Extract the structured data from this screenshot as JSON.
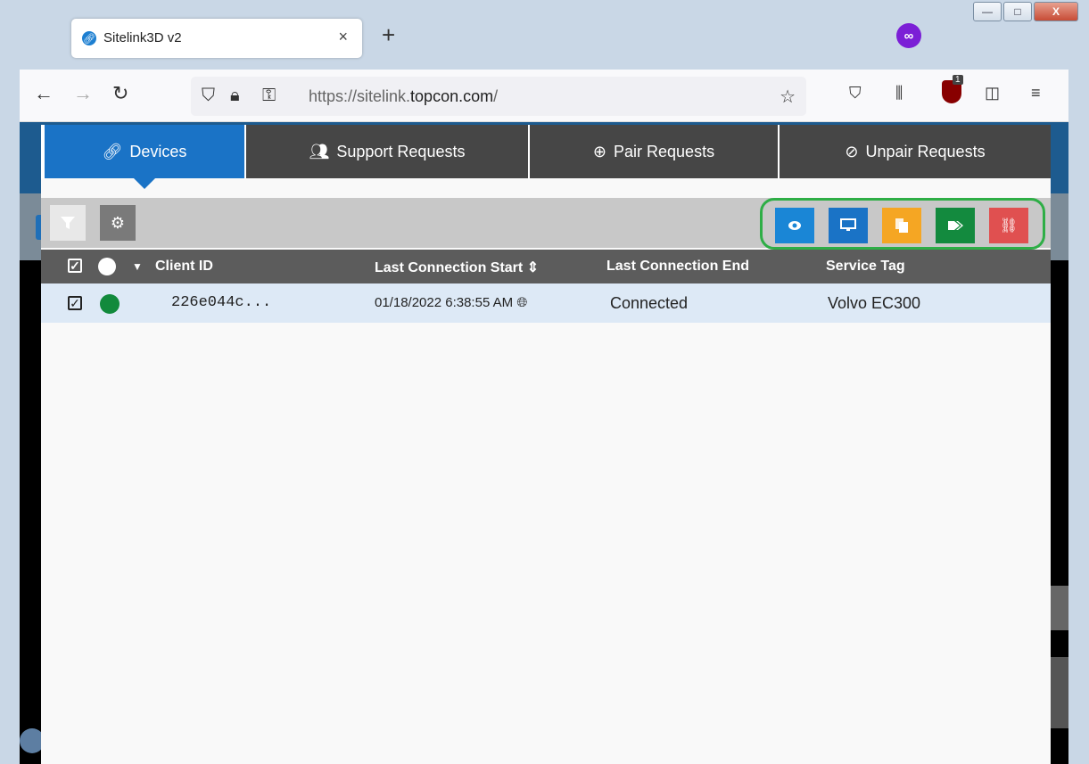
{
  "browser": {
    "tab_title": "Sitelink3D v2",
    "tab_close": "×",
    "new_tab": "+",
    "url_host_pre": "https://sitelink.",
    "url_host_bold": "topcon.com",
    "url_path": "/",
    "extension_badge_count": "1",
    "window_controls": {
      "minimize": "—",
      "maximize": "□",
      "close": "X"
    }
  },
  "modal": {
    "tabs": [
      {
        "label": "Devices",
        "icon": "link-icon",
        "active": true
      },
      {
        "label": "Support Requests",
        "icon": "users-gear-icon",
        "active": false
      },
      {
        "label": "Pair Requests",
        "icon": "plus-circle-icon",
        "active": false
      },
      {
        "label": "Unpair Requests",
        "icon": "ban-icon",
        "active": false
      }
    ],
    "actions": [
      {
        "name": "view",
        "icon": "eye-icon",
        "color": "#1a86d6"
      },
      {
        "name": "monitor",
        "icon": "monitor-icon",
        "color": "#1a73c6"
      },
      {
        "name": "copy",
        "icon": "files-icon",
        "color": "#f5a623"
      },
      {
        "name": "tags",
        "icon": "tags-icon",
        "color": "#138a3e"
      },
      {
        "name": "unlink",
        "icon": "unlink-icon",
        "color": "#e05050"
      }
    ],
    "table": {
      "columns": {
        "client_id": "Client ID",
        "last_start": "Last Connection Start",
        "last_end": "Last Connection End",
        "service_tag": "Service Tag"
      },
      "rows": [
        {
          "client_id": "226e044c...",
          "last_start": "01/18/2022 6:38:55 AM",
          "last_end": "Connected",
          "service_tag": "Volvo EC300",
          "status_color": "#128a3c"
        }
      ]
    }
  }
}
